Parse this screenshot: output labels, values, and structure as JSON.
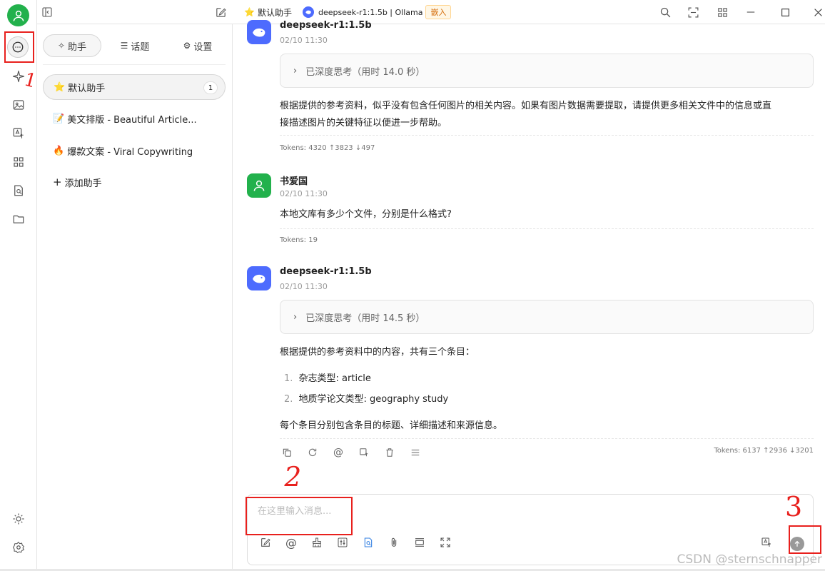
{
  "topbar": {
    "assistant_title": "默认助手",
    "model_label": "deepseek-r1:1.5b | Ollama",
    "embed_badge": "嵌入"
  },
  "panel": {
    "tabs": [
      {
        "label": "助手"
      },
      {
        "label": "话题"
      },
      {
        "label": "设置"
      }
    ],
    "assistants": [
      {
        "emoji": "⭐",
        "name": "默认助手",
        "count": "1"
      },
      {
        "emoji": "📝",
        "name": "美文排版 - Beautiful Article..."
      },
      {
        "emoji": "🔥",
        "name": "爆款文案 - Viral Copywriting"
      }
    ],
    "add_assistant": "添加助手"
  },
  "chat": {
    "messages": [
      {
        "author": "deepseek-r1:1.5b",
        "time": "02/10 11:30",
        "thinking": "已深度思考（用时 14.0 秒）",
        "text_line1": "根据提供的参考资料，似乎没有包含任何图片的相关内容。如果有图片数据需要提取，请提供更多相关文件中的信息或直",
        "text_line2": "接描述图片的关键特征以便进一步帮助。",
        "tokens": "Tokens: 4320 ↑3823 ↓497"
      },
      {
        "author": "书爱国",
        "time": "02/10 11:30",
        "text": "本地文库有多少个文件，分别是什么格式?",
        "tokens": "Tokens: 19"
      },
      {
        "author": "deepseek-r1:1.5b",
        "time": "02/10 11:30",
        "thinking": "已深度思考（用时 14.5 秒）",
        "intro": "根据提供的参考资料中的内容，共有三个条目：",
        "list": [
          {
            "num": "1.",
            "text": "杂志类型: article"
          },
          {
            "num": "2.",
            "text": "地质学论文类型: geography study"
          }
        ],
        "outro": "每个条目分别包含条目的标题、详细描述和来源信息。",
        "tokens": "Tokens: 6137 ↑2936 ↓3201"
      }
    ]
  },
  "input": {
    "placeholder": "在这里输入消息..."
  },
  "annotations": {
    "mark1": "1",
    "mark2": "2",
    "mark3": "3"
  },
  "watermark": "CSDN @sternschnapper",
  "colors": {
    "accent_green": "#22b14c",
    "deepseek_blue": "#4d6bfe",
    "annotation_red": "#e8201d"
  }
}
